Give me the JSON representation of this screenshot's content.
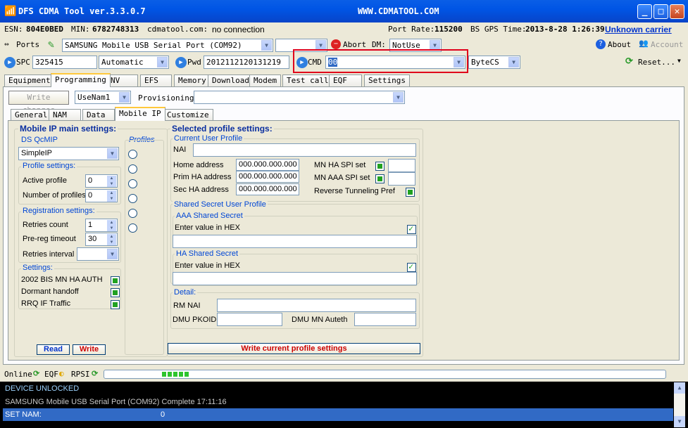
{
  "window": {
    "title": "DFS CDMA Tool ver.3.3.0.7",
    "site": "WWW.CDMATOOL.COM"
  },
  "infobar": {
    "esn_label": "ESN:",
    "esn": "804E0BED",
    "min_label": "MIN:",
    "min": "6782748313",
    "site": "cdmatool.com:",
    "conn": "no connection",
    "port_rate_label": "Port Rate:",
    "port_rate": "115200",
    "gps_label": "BS GPS Time:",
    "gps_time": "2013-8-28 1:26:39",
    "carrier": "Unknown carrier"
  },
  "toolbar1": {
    "ports": "Ports",
    "port_select": "SAMSUNG Mobile USB Serial Port  (COM92)",
    "abort": "Abort",
    "dm_label": "DM:",
    "dm_value": "NotUse",
    "about": "About",
    "account": "Account"
  },
  "toolbar2": {
    "spc_label": "SPC",
    "spc_value": "325415",
    "spc_mode": "Automatic",
    "pwd_label": "Pwd",
    "pwd_value": "2012112120131219",
    "cmd_label": "CMD",
    "cmd_value": "00",
    "cmd_type": "ByteCS",
    "reset": "Reset..."
  },
  "tabs": [
    "Equipment",
    "Programming",
    "NV",
    "EFS",
    "Memory",
    "Download",
    "Modem",
    "Test call",
    "EQF",
    "Settings"
  ],
  "prog_bar": {
    "write_changes": "Write changes",
    "namsel": "UseNam1",
    "prov_label": "Provisioning"
  },
  "subtabs": [
    "General",
    "NAM",
    "Data",
    "Mobile IP",
    "Customize"
  ],
  "mip": {
    "main_title": "Mobile IP main settings:",
    "ds_label": "DS QcMIP",
    "ds_value": "SimpleIP",
    "profiles_label": "Profiles",
    "profile_settings": "Profile settings:",
    "active_profile": "Active profile",
    "active_value": "0",
    "num_profiles": "Number of profiles",
    "num_value": "0",
    "reg_settings": "Registration settings:",
    "retries_count": "Retries count",
    "retries_value": "1",
    "prereg": "Pre-reg timeout",
    "prereg_value": "30",
    "retries_interval": "Retries interval",
    "settings": "Settings:",
    "opt1": "2002 BIS MN HA AUTH",
    "opt2": "Dormant handoff",
    "opt3": "RRQ IF Traffic",
    "read": "Read",
    "write": "Write"
  },
  "sel": {
    "title": "Selected profile settings:",
    "current_user": "Current User Profile",
    "nai": "NAI",
    "home": "Home address",
    "home_val": "000.000.000.000",
    "prim": "Prim HA address",
    "prim_val": "000.000.000.000",
    "sec": "Sec HA address",
    "sec_val": "000.000.000.000",
    "mnha": "MN HA SPI set",
    "mnaaa": "MN AAA SPI set",
    "reverse": "Reverse Tunneling Pref",
    "shared": "Shared Secret User Profile",
    "aaa": "AAA Shared Secret",
    "enter_hex1": "Enter value in HEX",
    "ha": "HA Shared Secret",
    "enter_hex2": "Enter value in HEX",
    "detail": "Detail:",
    "rm_nai": "RM NAI",
    "dmu_pkoid": "DMU PKOID",
    "dmu_mn": "DMU MN Auteth",
    "write_current": "Write current profile settings"
  },
  "status": {
    "online": "Online",
    "eqf": "EQF",
    "rpsi": "RPSI"
  },
  "log": [
    {
      "text": "DEVICE UNLOCKED",
      "value": ""
    },
    {
      "text": "SAMSUNG Mobile USB Serial Port  (COM92)  Complete   17:11:16",
      "value": ""
    },
    {
      "text": "SET NAM:",
      "value": "0"
    }
  ],
  "colors": {
    "accent": "#0046d5",
    "log_bg": "#000000",
    "log_sel": "#316ac5",
    "highlight_box": "#e0001b"
  }
}
